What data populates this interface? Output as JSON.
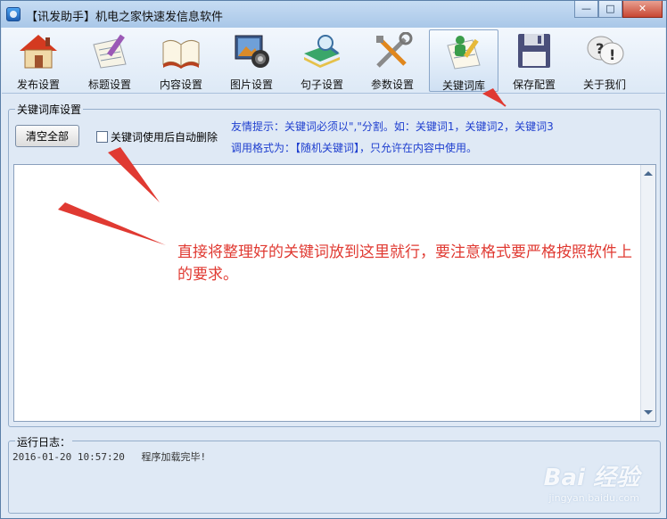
{
  "window": {
    "title": "【讯发助手】机电之家快速发信息软件",
    "minimize": "—",
    "maximize": "□",
    "close": "✕"
  },
  "toolbar": {
    "items": [
      {
        "label": "发布设置",
        "icon": "house-icon"
      },
      {
        "label": "标题设置",
        "icon": "notepad-pen-icon"
      },
      {
        "label": "内容设置",
        "icon": "book-icon"
      },
      {
        "label": "图片设置",
        "icon": "photo-camera-icon"
      },
      {
        "label": "句子设置",
        "icon": "magnifier-book-icon"
      },
      {
        "label": "参数设置",
        "icon": "tools-icon"
      },
      {
        "label": "关键词库",
        "icon": "person-notepad-icon",
        "active": true
      },
      {
        "label": "保存配置",
        "icon": "floppy-disk-icon"
      },
      {
        "label": "关于我们",
        "icon": "question-bubble-icon"
      }
    ]
  },
  "keyword_panel": {
    "legend": "关键词库设置",
    "clear_button": "清空全部",
    "auto_delete_checkbox": {
      "label": "关键词使用后自动删除",
      "checked": false
    },
    "tip_line1": "友情提示：关键词必须以\",\"分割。如：关键词1，关键词2，关键词3",
    "tip_line2": "调用格式为：【随机关键词】，只允许在内容中使用。",
    "textarea_value": ""
  },
  "annotation": {
    "text": "直接将整理好的关键词放到这里就行，要注意格式要严格按照软件上的要求。",
    "color": "#e03a32"
  },
  "log": {
    "legend": "运行日志：",
    "entries": [
      {
        "time": "2016-01-20 10:57:20",
        "message": "程序加载完毕!"
      }
    ]
  },
  "watermark": {
    "logo": "Bai 经验",
    "url": "jingyan.baidu.com"
  }
}
